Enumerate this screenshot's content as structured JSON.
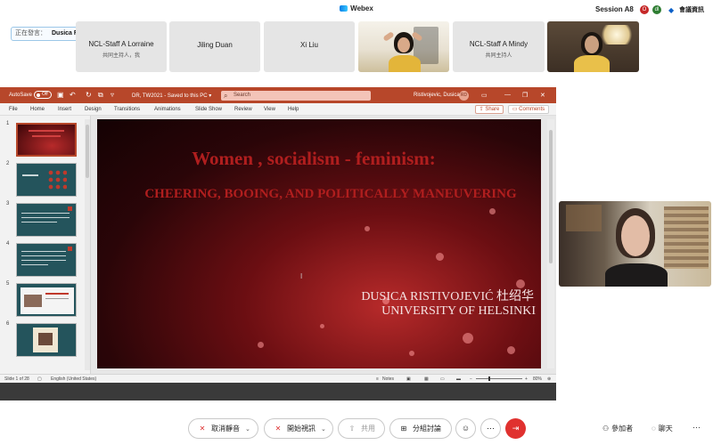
{
  "window": {
    "app_title": "Webex",
    "session": "Session A8",
    "rec_indicator": "O",
    "user_initial": "dl",
    "meeting_info_label": "會議資訊"
  },
  "speaking": {
    "label": "正在發言：",
    "name": "Dusica Ristivojevic"
  },
  "participants": [
    {
      "name": "NCL-Staff A Lorraine",
      "role": "共同主持人，我"
    },
    {
      "name": "Jiling Duan",
      "role": ""
    },
    {
      "name": "Xi Liu",
      "role": ""
    },
    {
      "name": "NCL-Staff A Mindy",
      "role": "共同主持人"
    }
  ],
  "ppt": {
    "autosave": "AutoSave",
    "toggle": "Off",
    "doc_name": "DR, TW2021 - Saved to this PC ▾",
    "search_placeholder": "Search",
    "user": "Ristivojevic, Dusica",
    "user_initials": "RD",
    "tabs": [
      "File",
      "Home",
      "Insert",
      "Design",
      "Transitions",
      "Animations",
      "Slide Show",
      "Review",
      "View",
      "Help"
    ],
    "share_label": "Share",
    "comments_label": "Comments",
    "thumb_numbers": [
      "1",
      "2",
      "3",
      "4",
      "5",
      "6"
    ],
    "status_slide": "Slide 1 of 28",
    "status_lang": "English (United States)",
    "status_notes": "Notes",
    "zoom": "80%"
  },
  "slide": {
    "title": "Women , socialism - feminism:",
    "subtitle": "CHEERING, BOOING, AND POLITICALLY MANEUVERING",
    "author": "DUSICA RISTIVOJEVIĆ 杜绍华",
    "university": "UNIVERSITY OF HELSINKI"
  },
  "controls": {
    "mute": "取消靜音",
    "video": "開始視訊",
    "share": "共用",
    "breakout": "分組討論",
    "participants": "參加者",
    "chat": "聊天"
  },
  "colors": {
    "ppt_accent": "#b7472a",
    "leave_button": "#e0312f",
    "share_border": "#3a8ee6"
  }
}
